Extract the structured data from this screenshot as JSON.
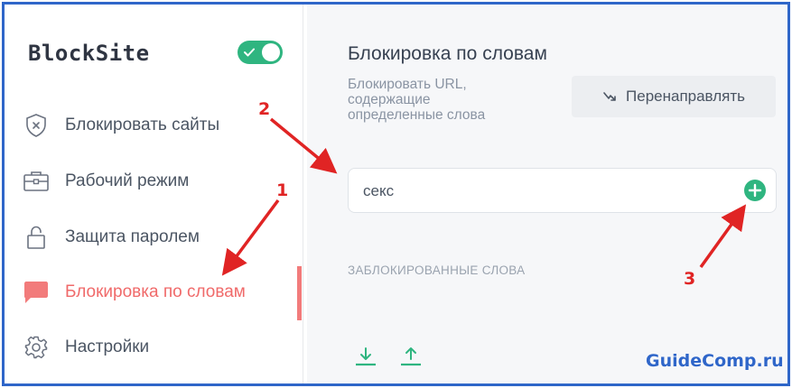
{
  "app": {
    "logo_text": "BlockSite",
    "toggle_on": true
  },
  "sidebar": {
    "items": [
      {
        "label": "Блокировать сайты",
        "icon": "shield-icon"
      },
      {
        "label": "Рабочий режим",
        "icon": "briefcase-icon"
      },
      {
        "label": "Защита паролем",
        "icon": "lock-icon"
      },
      {
        "label": "Блокировка по словам",
        "icon": "speech-bubble-icon",
        "active": true
      },
      {
        "label": "Настройки",
        "icon": "gear-icon"
      }
    ]
  },
  "main": {
    "title": "Блокировка по словам",
    "description": "Блокировать URL, содержащие определенные слова",
    "redirect_label": "Перенаправлять",
    "word_input_value": "секс",
    "blocked_words_header": "ЗАБЛОКИРОВАННЫЕ СЛОВА"
  },
  "annotations": {
    "labels": [
      "1",
      "2",
      "3"
    ],
    "watermark": "GuideComp.ru"
  },
  "colors": {
    "accent_green": "#2fb580",
    "active_red": "#f06a6a",
    "annotation_red": "#e02424",
    "frame_blue": "#2f66c9"
  }
}
